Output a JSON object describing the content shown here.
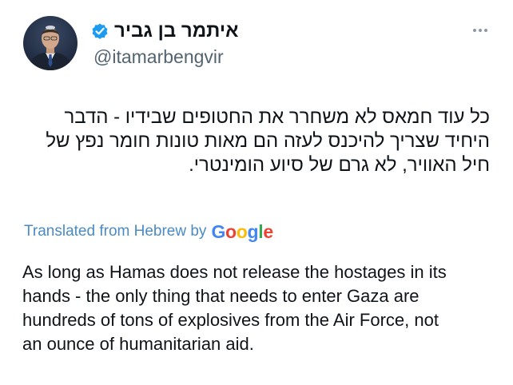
{
  "author": {
    "display_name": "איתמר בן גביר",
    "handle": "@itamarbengvir",
    "verified_icon": "verified-badge-icon",
    "verified_color": "#1d9bf0",
    "avatar": "profile-photo"
  },
  "more_icon": "more-options-icon",
  "tweet": {
    "hebrew_lines": [
      "כל עוד חמאס לא משחרר את החטופים שבידיו -  הדבר",
      "היחיד שצריך להיכנס לעזה הם מאות טונות חומר נפץ של",
      "חיל האוויר, לא גרם של סיוע הומינטרי."
    ],
    "translation_label": "Translated from Hebrew by",
    "translation_provider": "Google",
    "english_lines": [
      "As long as Hamas does not release the hostages in its",
      "hands - the only thing that needs to enter Gaza are",
      "hundreds of tons of explosives from the Air Force, not",
      "an ounce of humanitarian aid."
    ]
  },
  "colors": {
    "link_blue": "#4a8bc4",
    "text_primary": "#0f1419",
    "text_secondary": "#536471"
  }
}
